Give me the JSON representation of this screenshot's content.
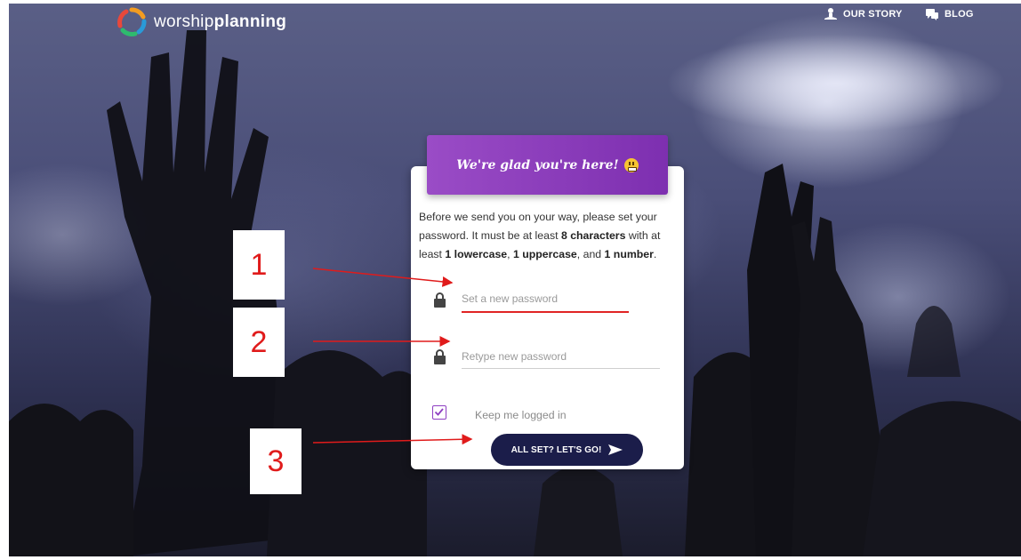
{
  "header": {
    "logo_text_light": "worship",
    "logo_text_bold": "planning",
    "nav": [
      {
        "label": "OUR STORY",
        "icon": "speaker-icon"
      },
      {
        "label": "BLOG",
        "icon": "chat-icon"
      }
    ]
  },
  "card": {
    "banner_title": "We're glad you're here!",
    "intro": {
      "part1": "Before we send you on your way, please set your password. It must be at least ",
      "bold1": "8 characters",
      "part2": " with at least ",
      "bold2": "1 lowercase",
      "part3": ", ",
      "bold3": "1 uppercase",
      "part4": ", and ",
      "bold4": "1 number",
      "part5": "."
    },
    "password": {
      "placeholder": "Set a new password",
      "value": ""
    },
    "retype": {
      "placeholder": "Retype new password",
      "value": ""
    },
    "keep_logged_in": {
      "label": "Keep me logged in",
      "checked": true
    },
    "submit_label": "ALL SET? LET'S GO!"
  },
  "annotations": [
    {
      "number": "1"
    },
    {
      "number": "2"
    },
    {
      "number": "3"
    }
  ],
  "colors": {
    "accent": "#8e3fc2",
    "banner_start": "#9a4cc6",
    "banner_end": "#7d2fb0",
    "button": "#1b1d4a",
    "error_underline": "#e02424",
    "annotation": "#e01b1b"
  }
}
